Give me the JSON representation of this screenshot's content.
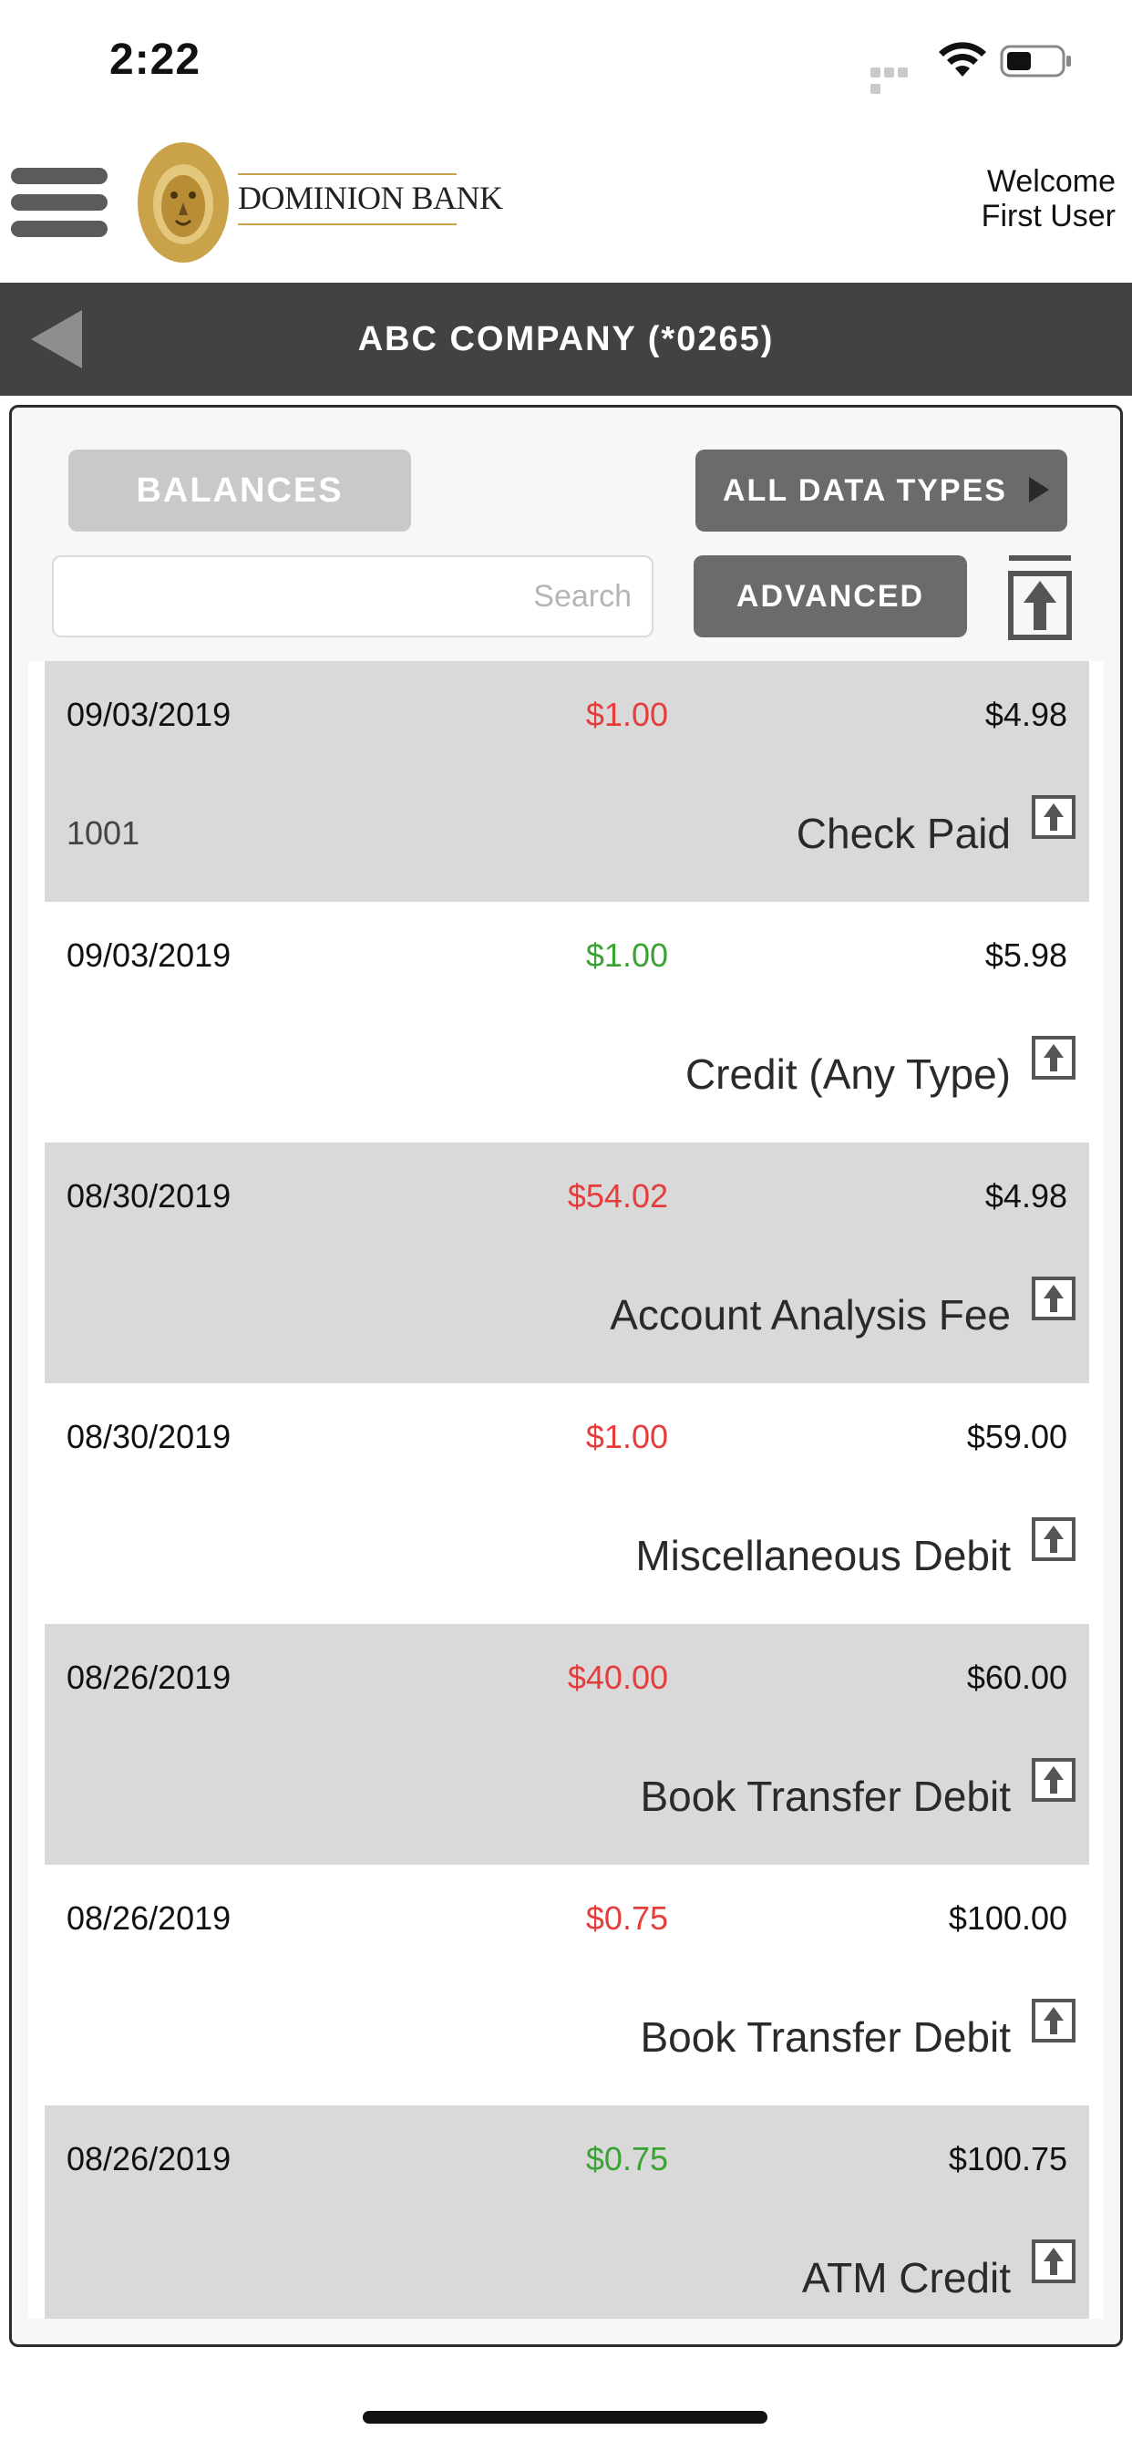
{
  "status_bar": {
    "time": "2:22"
  },
  "header": {
    "logo_text": "DOMINION BANK",
    "welcome_line1": "Welcome",
    "welcome_line2": "First User"
  },
  "account": {
    "title": "ABC COMPANY (*0265)"
  },
  "controls": {
    "balances_label": "BALANCES",
    "all_data_types_label": "ALL DATA TYPES",
    "search_placeholder": "Search",
    "search_value": "",
    "advanced_label": "ADVANCED"
  },
  "colors": {
    "debit": "#e53c3c",
    "credit": "#3aa333",
    "account_bar": "#424241",
    "row_shade": "#d9d9d9"
  },
  "transactions": [
    {
      "date": "09/03/2019",
      "amount": "$1.00",
      "type": "debit",
      "balance": "$4.98",
      "ref": "1001",
      "description": "Check Paid"
    },
    {
      "date": "09/03/2019",
      "amount": "$1.00",
      "type": "credit",
      "balance": "$5.98",
      "ref": "",
      "description": "Credit (Any Type)"
    },
    {
      "date": "08/30/2019",
      "amount": "$54.02",
      "type": "debit",
      "balance": "$4.98",
      "ref": "",
      "description": "Account Analysis Fee"
    },
    {
      "date": "08/30/2019",
      "amount": "$1.00",
      "type": "debit",
      "balance": "$59.00",
      "ref": "",
      "description": "Miscellaneous Debit"
    },
    {
      "date": "08/26/2019",
      "amount": "$40.00",
      "type": "debit",
      "balance": "$60.00",
      "ref": "",
      "description": "Book Transfer Debit"
    },
    {
      "date": "08/26/2019",
      "amount": "$0.75",
      "type": "debit",
      "balance": "$100.00",
      "ref": "",
      "description": "Book Transfer Debit"
    },
    {
      "date": "08/26/2019",
      "amount": "$0.75",
      "type": "credit",
      "balance": "$100.75",
      "ref": "",
      "description": "ATM Credit"
    }
  ]
}
